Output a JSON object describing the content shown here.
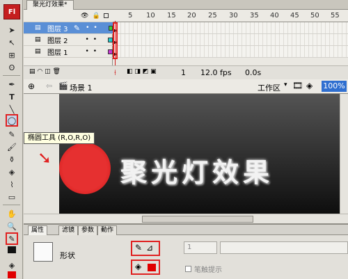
{
  "app": {
    "logo": "Fl",
    "document_tab": "聚光灯效果*"
  },
  "timeline": {
    "frame_numbers": [
      "5",
      "10",
      "15",
      "20",
      "25",
      "30",
      "35",
      "40",
      "45",
      "50",
      "55"
    ],
    "layers": [
      {
        "name": "图层 3"
      },
      {
        "name": "图层 2"
      },
      {
        "name": "图层 1"
      }
    ],
    "status": {
      "frame": "1",
      "fps": "12.0 fps",
      "time": "0.0s"
    }
  },
  "editbar": {
    "scene": "场景 1",
    "workspace": "工作区",
    "zoom": "100%"
  },
  "stage": {
    "title_text": "聚光灯效果",
    "circle_color": "#e02020"
  },
  "tooltip": "椭圆工具 (R,O,R,O)",
  "properties": {
    "tabs": [
      "属性",
      "滤镜",
      "参数",
      "動作"
    ],
    "shape_label": "形状",
    "stroke_value": "1",
    "hint_label": "笔触提示",
    "fill_color": "#e00000"
  }
}
